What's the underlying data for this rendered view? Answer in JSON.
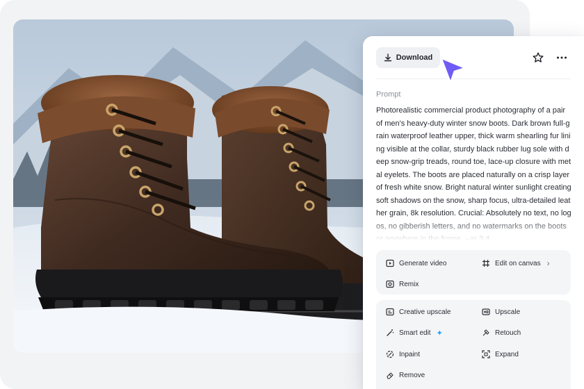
{
  "toolbar": {
    "download_label": "Download"
  },
  "prompt": {
    "label": "Prompt",
    "text": "Photorealistic commercial product photography of a pair of men's heavy-duty winter snow boots. Dark brown full-grain waterproof leather upper, thick warm shearling fur lining visible at the collar, sturdy black rubber lug sole with deep snow-grip treads, round toe, lace-up closure with metal eyelets. The boots are placed naturally on a crisp layer of fresh white snow. Bright natural winter sunlight creating soft shadows on the snow, sharp focus, ultra-detailed leather grain, 8k resolution. Crucial: Absolutely no text, no logos, no gibberish letters, and no watermarks on the boots or anywhere in the frame. --ar 3:4"
  },
  "actions_primary": [
    {
      "label": "Generate video",
      "icon": "play-icon"
    },
    {
      "label": "Edit on canvas",
      "icon": "canvas-icon"
    },
    {
      "label": "Remix",
      "icon": "remix-icon"
    }
  ],
  "actions_tools": [
    {
      "label": "Creative upscale",
      "icon": "creative-upscale-icon"
    },
    {
      "label": "Upscale",
      "icon": "hd-icon"
    },
    {
      "label": "Smart edit",
      "icon": "magic-wand-icon"
    },
    {
      "label": "Retouch",
      "icon": "retouch-icon"
    },
    {
      "label": "Inpaint",
      "icon": "inpaint-icon"
    },
    {
      "label": "Expand",
      "icon": "expand-icon"
    },
    {
      "label": "Remove",
      "icon": "eraser-icon"
    }
  ],
  "colors": {
    "accent_cursor": "#6f5cf6",
    "sparkle": "#1fa0ff",
    "panel_bg": "#ffffff",
    "page_bg": "#f2f3f5"
  }
}
